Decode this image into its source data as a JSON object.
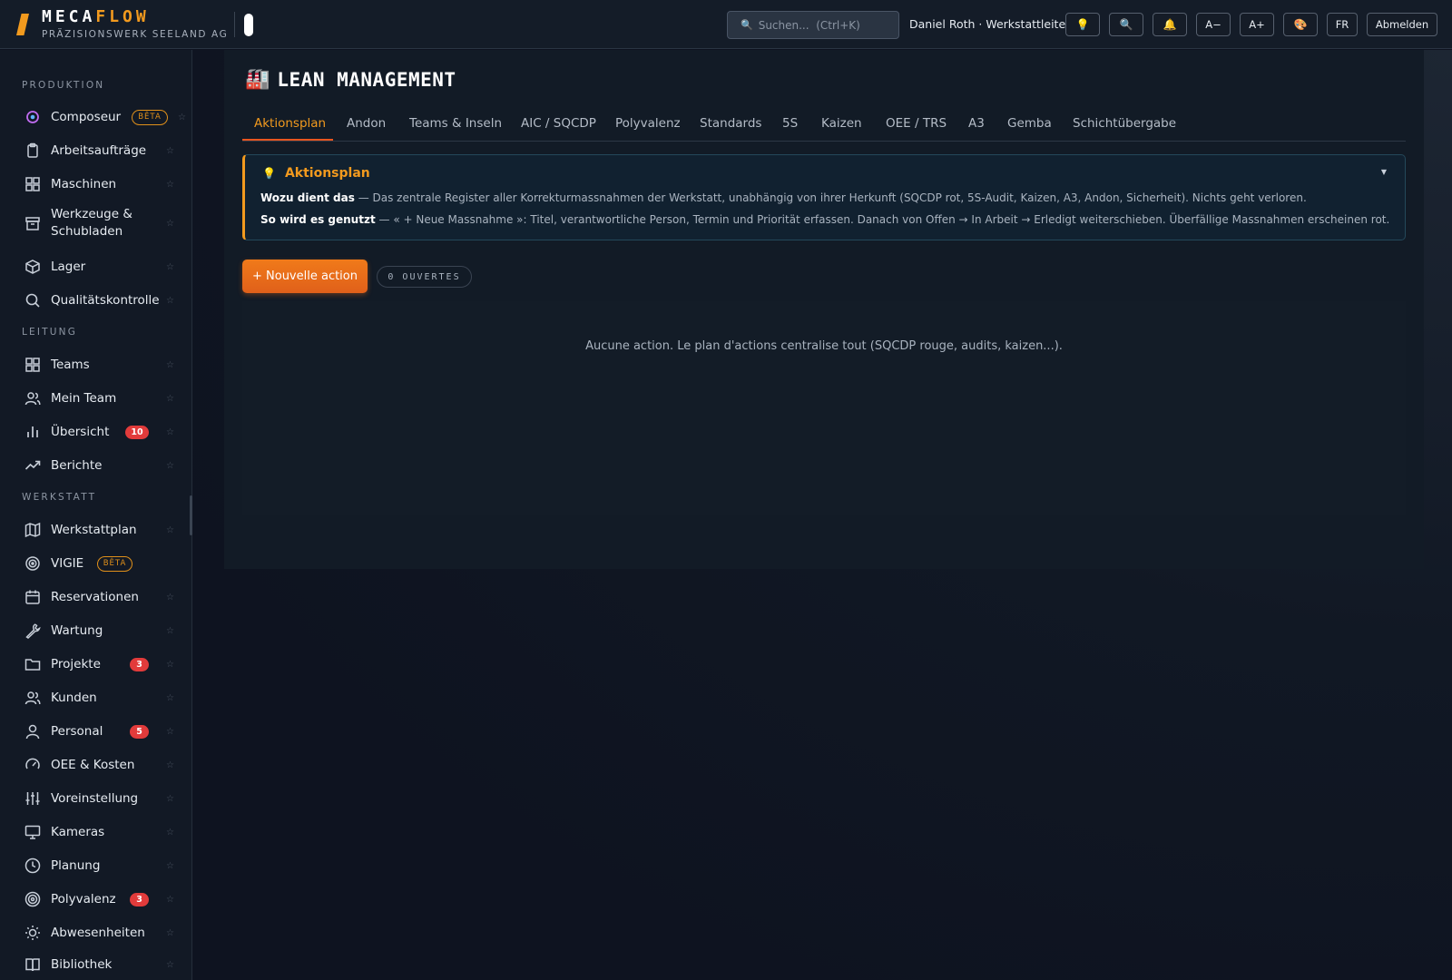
{
  "brand": {
    "name_part1": "MECA",
    "name_part2": "FLOW",
    "subtitle": "PRÄZISIONSWERK SEELAND AG"
  },
  "search": {
    "placeholder": "Suchen...  (Ctrl+K)"
  },
  "user": {
    "label": "Daniel Roth · Werkstattleiter"
  },
  "toolbar": {
    "font_smaller": "A−",
    "font_larger": "A+",
    "language": "FR",
    "logout": "Abmelden"
  },
  "sidebar": {
    "sections": [
      {
        "title": "PRODUKTION",
        "items": [
          {
            "label": "Composeur",
            "icon": "composer-icon",
            "badge": "BÊTA"
          },
          {
            "label": "Arbeitsaufträge",
            "icon": "clipboard-icon"
          },
          {
            "label": "Maschinen",
            "icon": "grid-icon"
          },
          {
            "label": "Werkzeuge & Schubladen",
            "icon": "drawer-icon"
          },
          {
            "label": "Lager",
            "icon": "box-icon"
          },
          {
            "label": "Qualitätskontrolle",
            "icon": "search-icon"
          }
        ]
      },
      {
        "title": "LEITUNG",
        "items": [
          {
            "label": "Teams",
            "icon": "grid-icon"
          },
          {
            "label": "Mein Team",
            "icon": "users-icon"
          },
          {
            "label": "Übersicht",
            "icon": "bar-chart-icon",
            "count": "10"
          },
          {
            "label": "Berichte",
            "icon": "trend-icon"
          }
        ]
      },
      {
        "title": "WERKSTATT",
        "items": [
          {
            "label": "Werkstattplan",
            "icon": "map-icon"
          },
          {
            "label": "VIGIE",
            "icon": "target-icon",
            "badge": "BÊTA"
          },
          {
            "label": "Reservationen",
            "icon": "calendar-icon"
          },
          {
            "label": "Wartung",
            "icon": "wrench-icon"
          },
          {
            "label": "Projekte",
            "icon": "folder-icon",
            "count": "3"
          },
          {
            "label": "Kunden",
            "icon": "users-icon"
          },
          {
            "label": "Personal",
            "icon": "user-icon",
            "count": "5"
          },
          {
            "label": "OEE & Kosten",
            "icon": "gauge-icon"
          },
          {
            "label": "Voreinstellung",
            "icon": "sliders-icon"
          },
          {
            "label": "Kameras",
            "icon": "monitor-icon"
          },
          {
            "label": "Planung",
            "icon": "clock-icon"
          },
          {
            "label": "Polyvalenz",
            "icon": "target-icon",
            "count": "3"
          },
          {
            "label": "Abwesenheiten",
            "icon": "sun-icon"
          },
          {
            "label": "Bibliothek",
            "icon": "book-icon"
          }
        ]
      }
    ]
  },
  "page": {
    "title": "LEAN MANAGEMENT",
    "title_icon": "factory-icon"
  },
  "tabs": [
    "Aktionsplan",
    "Andon",
    "Teams & Inseln",
    "AIC / SQCDP",
    "Polyvalenz",
    "Standards",
    "5S",
    "Kaizen",
    "OEE / TRS",
    "A3",
    "Gemba",
    "Schichtübergabe"
  ],
  "active_tab": "Aktionsplan",
  "info": {
    "title": "Aktionsplan",
    "line1_label": "Wozu dient das",
    "line1_text": " — Das zentrale Register aller Korrekturmassnahmen der Werkstatt, unabhängig von ihrer Herkunft (SQCDP rot, 5S-Audit, Kaizen, A3, Andon, Sicherheit). Nichts geht verloren.",
    "line2_label": "So wird es genutzt",
    "line2_text": " — « + Neue Massnahme »: Titel, verantwortliche Person, Termin und Priorität erfassen. Danach von Offen → In Arbeit → Erledigt weiterschieben. Überfällige Massnahmen erscheinen rot."
  },
  "actions": {
    "new_button": "+ Nouvelle action",
    "open_count": "0 OUVERTES"
  },
  "empty_message": "Aucune action. Le plan d'actions centralise tout (SQCDP rouge, audits, kaizen...).",
  "colors": {
    "accent": "#f29a1e",
    "cta": "#f07a1a",
    "badge_red": "#e23b3b",
    "background": "#0e1320"
  }
}
